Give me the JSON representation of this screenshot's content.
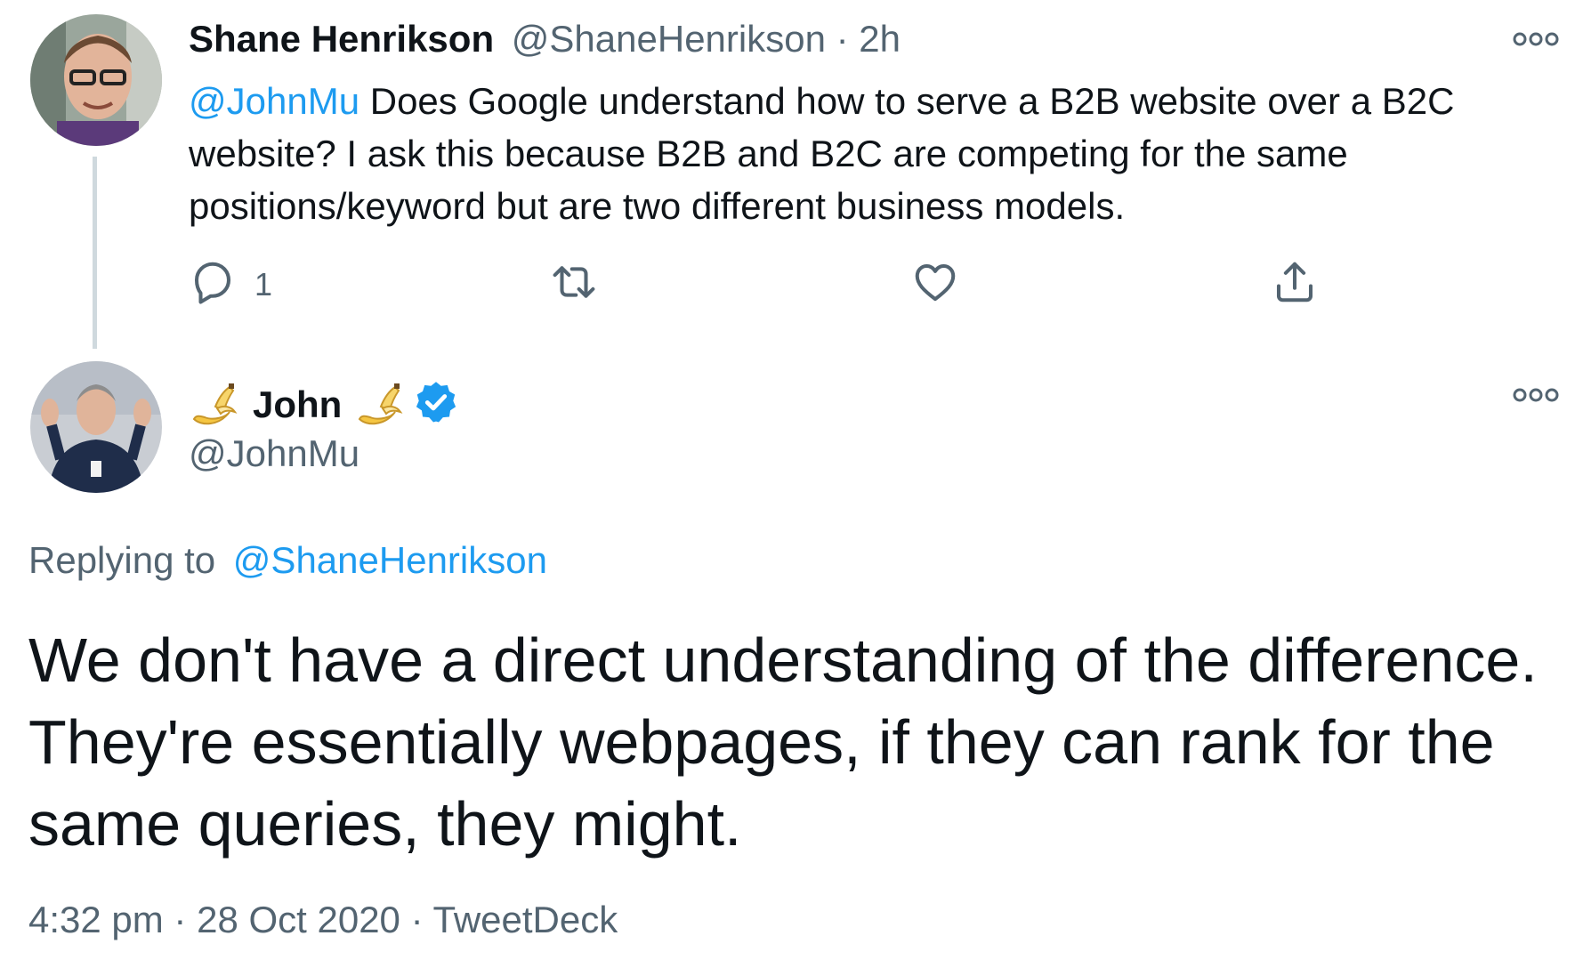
{
  "tweet1": {
    "name": "Shane Henrikson",
    "handle": "@ShaneHenrikson",
    "separator": " · ",
    "time": "2h",
    "mention": "@JohnMu",
    "text": " Does Google understand how to serve a B2B website over a B2C website? I ask this because B2B and B2C are competing for the same positions/keyword but are two different business models.",
    "reply_count": "1",
    "icons": [
      "reply-icon",
      "retweet-icon",
      "like-icon",
      "share-icon",
      "more-icon"
    ]
  },
  "tweet2": {
    "name": "John",
    "handle": "@JohnMu",
    "verified": true,
    "name_emoji": "banana-emoji",
    "replying_label": "Replying to",
    "replying_to": "@ShaneHenrikson",
    "text": "We don't have a direct understanding of the difference. They're essentially webpages, if they can rank for the same queries, they might.",
    "time": "4:32 pm",
    "date": "28 Oct 2020",
    "source": "TweetDeck",
    "meta_sep": " · "
  },
  "colors": {
    "link": "#1d9bf0",
    "gray": "#536471",
    "text": "#0f1419",
    "thread_line": "#cfd9de",
    "verified": "#1d9bf0"
  }
}
